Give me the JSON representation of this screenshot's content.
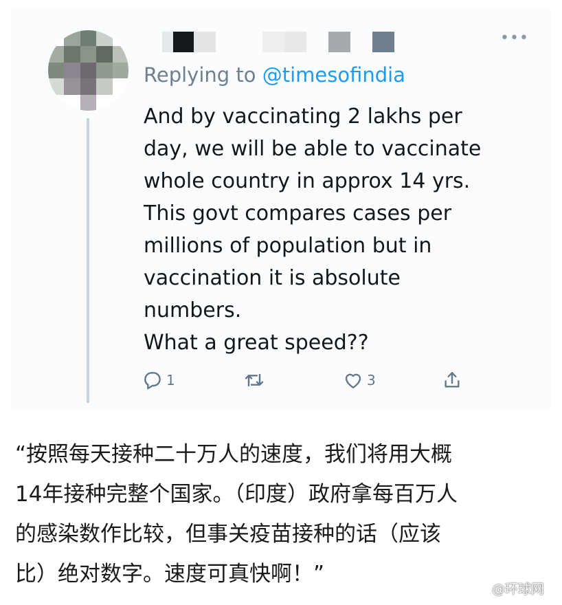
{
  "tweet": {
    "replying_prefix": "Replying to",
    "replying_handle": "@timesofindia",
    "body_lines": [
      "And by vaccinating 2 lakhs per",
      "day, we will be able to vaccinate",
      "whole country in approx 14 yrs.",
      "This govt compares cases per",
      "millions of population but in",
      "vaccination it is absolute",
      "numbers.",
      "What a great speed??"
    ],
    "actions": {
      "reply_count": "1",
      "like_count": "3"
    },
    "icons": {
      "more": "more-horizontal-icon",
      "reply": "comment-icon",
      "retweet": "retweet-icon",
      "like": "heart-icon",
      "share": "share-icon"
    }
  },
  "caption_lines": [
    "“按照每天接种二十万人的速度，我们将用大概",
    "14年接种完整个国家。（印度）政府拿每百万人",
    "的感染数作比较，但事关疫苗接种的话（应该",
    "比）绝对数字。速度可真快啊！”"
  ],
  "watermark": {
    "text": "@环球网",
    "icon": "weibo-logo-icon"
  },
  "colors": {
    "handle": "#1d9bf0",
    "action_icon": "#657786",
    "text": "#14171a"
  }
}
